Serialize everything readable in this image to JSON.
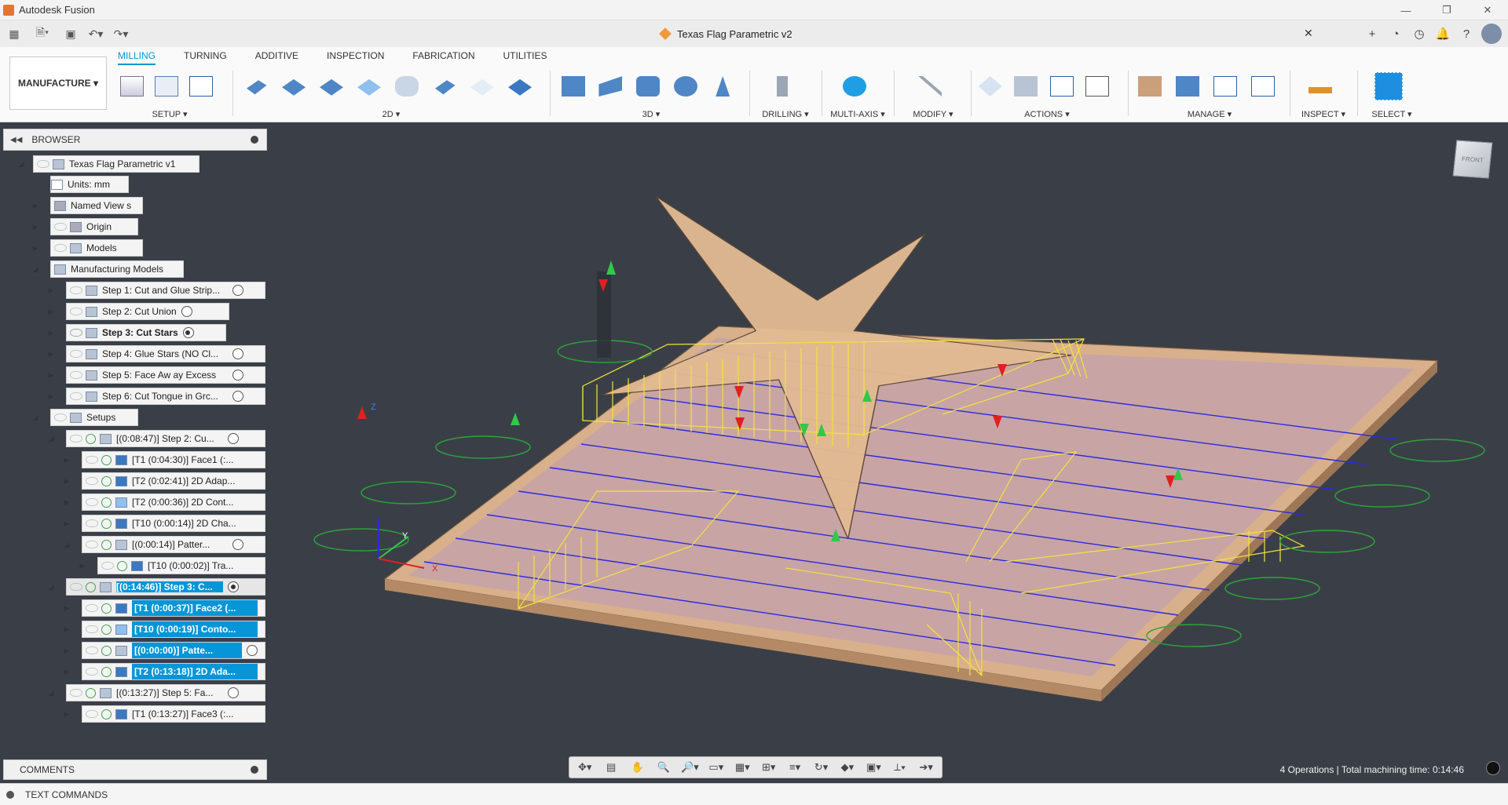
{
  "app": {
    "title": "Autodesk Fusion"
  },
  "window_buttons": [
    "—",
    "❐",
    "✕"
  ],
  "document": {
    "title": "Texas Flag Parametric v2",
    "close": "✕"
  },
  "workspace": {
    "label": "MANUFACTURE ▾"
  },
  "ribbon_tabs": [
    "MILLING",
    "TURNING",
    "ADDITIVE",
    "INSPECTION",
    "FABRICATION",
    "UTILITIES"
  ],
  "ribbon_groups": {
    "setup": "SETUP ▾",
    "g2d": "2D ▾",
    "g3d": "3D ▾",
    "drilling": "DRILLING ▾",
    "multiaxis": "MULTI-AXIS ▾",
    "modify": "MODIFY ▾",
    "actions": "ACTIONS ▾",
    "manage": "MANAGE ▾",
    "inspect": "INSPECT ▾",
    "select": "SELECT ▾"
  },
  "browser": {
    "title": "BROWSER",
    "root": "Texas Flag Parametric v1",
    "units": "Units: mm",
    "named_views": "Named View s",
    "origin": "Origin",
    "models": "Models",
    "manufacturing_models": "Manufacturing Models",
    "steps": [
      "Step 1: Cut and Glue Strip...",
      "Step 2: Cut Union",
      "Step 3: Cut Stars",
      "Step 4: Glue Stars (NO Cl...",
      "Step 5: Face Aw ay Excess",
      "Step 6: Cut Tongue in Grc..."
    ],
    "setups": "Setups",
    "setup_items": [
      "[(0:08:47)] Step 2: Cu...",
      "[T1 (0:04:30)] Face1 (:...",
      "[T2 (0:02:41)] 2D Adap...",
      "[T2 (0:00:36)] 2D Cont...",
      "[T10 (0:00:14)] 2D Cha...",
      "[(0:00:14)] Patter...",
      "[T10 (0:00:02)] Tra...",
      "[(0:14:46)] Step 3: C...",
      "[T1 (0:00:37)] Face2 (...",
      "[T10 (0:00:19)] Conto...",
      "[(0:00:00)] Patte...",
      "[T2 (0:13:18)] 2D Ada...",
      "[(0:13:27)] Step 5: Fa...",
      "[T1 (0:13:27)] Face3 (:..."
    ]
  },
  "viewcube": {
    "label": "FRONT"
  },
  "comments": {
    "title": "COMMENTS"
  },
  "text_commands": {
    "label": "TEXT COMMANDS"
  },
  "status": {
    "text": "4 Operations | Total machining time: 0:14:46"
  },
  "axes": {
    "x": "X",
    "y": "Y",
    "z": "Z"
  },
  "colors": {
    "accent": "#0696d7",
    "toolpath_blue": "#2a2ae0",
    "toolpath_yellow": "#f2e33c",
    "wood": "#d9b08c"
  }
}
